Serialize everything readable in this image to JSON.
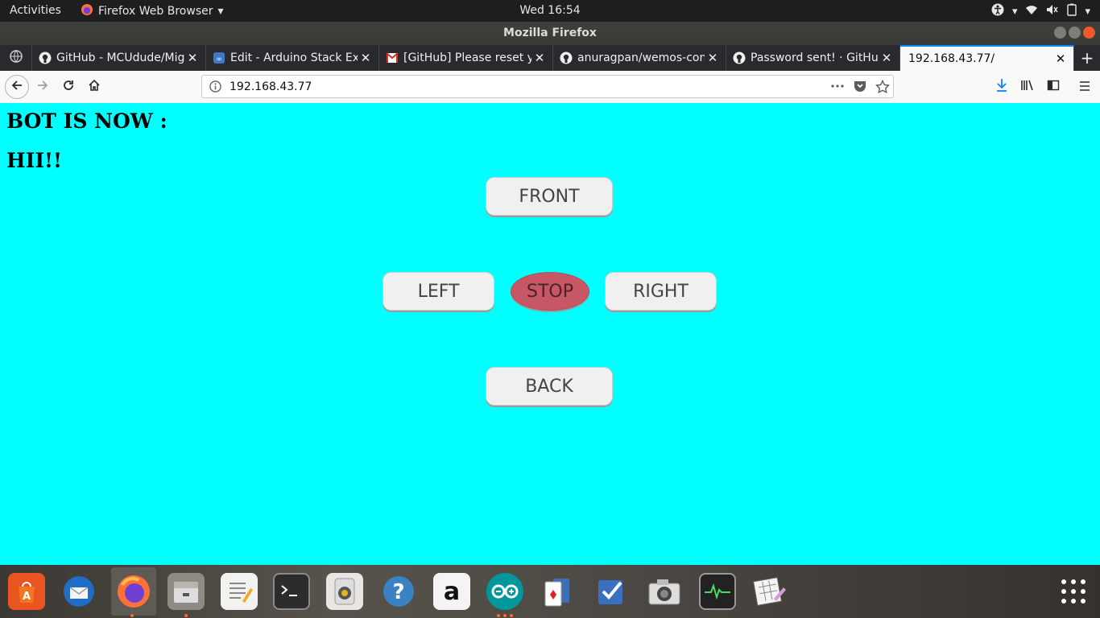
{
  "topbar": {
    "activities": "Activities",
    "app_name": "Firefox Web Browser",
    "clock": "Wed 16:54"
  },
  "window": {
    "title": "Mozilla Firefox"
  },
  "tabs": [
    {
      "label": "GitHub - MCUdude/Mig",
      "icon": "github-icon"
    },
    {
      "label": "Edit - Arduino Stack Exc",
      "icon": "stackexchange-icon"
    },
    {
      "label": "[GitHub] Please reset yo",
      "icon": "gmail-icon"
    },
    {
      "label": "anuragpan/wemos-con",
      "icon": "github-icon"
    },
    {
      "label": "Password sent! · GitHub",
      "icon": "github-icon"
    },
    {
      "label": "192.168.43.77/",
      "icon": "none",
      "active": true
    }
  ],
  "navbar": {
    "url": "192.168.43.77"
  },
  "page": {
    "heading1": "BOT IS NOW :",
    "heading2": "HII!!",
    "buttons": {
      "front": "FRONT",
      "left": "LEFT",
      "stop": "STOP",
      "right": "RIGHT",
      "back": "BACK"
    },
    "colors": {
      "background": "#00ffff",
      "stop": "#c75764",
      "button": "#f0f0f0"
    }
  },
  "dock": {
    "apps": [
      "ubuntu-software-icon",
      "thunderbird-icon",
      "firefox-icon",
      "files-icon",
      "text-editor-icon",
      "terminal-icon",
      "rhythmbox-icon",
      "help-icon",
      "amazon-icon",
      "arduino-icon",
      "solitaire-icon",
      "tasks-icon",
      "camera-icon",
      "system-monitor-icon",
      "sudoku-icon",
      "show-apps-icon"
    ],
    "amazon_letter": "a"
  }
}
